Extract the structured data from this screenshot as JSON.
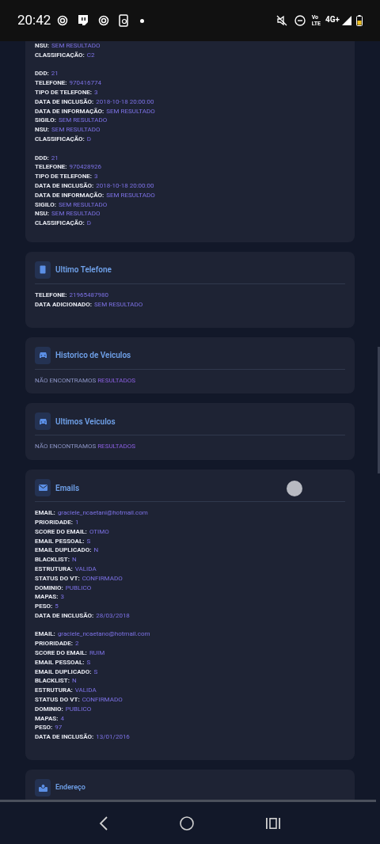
{
  "status_bar": {
    "time": "20:42",
    "volte": [
      "Vo",
      "LTE"
    ],
    "network": "4G+"
  },
  "cards": [
    {
      "groups": [
        [
          {
            "label": "NSU:",
            "value": "SEM RESULTADO"
          },
          {
            "label": "CLASSIFICAÇÃO:",
            "value": "C2"
          }
        ],
        [
          {
            "label": "DDD:",
            "value": "21"
          },
          {
            "label": "TELEFONE:",
            "value": "970416774"
          },
          {
            "label": "TIPO DE TELEFONE:",
            "value": "3"
          },
          {
            "label": "DATA DE INCLUSÃO:",
            "value": "2018-10-18 20:00:00"
          },
          {
            "label": "DATA DE INFORMAÇÃO:",
            "value": "SEM RESULTADO"
          },
          {
            "label": "SIGILO:",
            "value": "SEM RESULTADO"
          },
          {
            "label": "NSU:",
            "value": "SEM RESULTADO"
          },
          {
            "label": "CLASSIFICAÇÃO:",
            "value": "D"
          }
        ],
        [
          {
            "label": "DDD:",
            "value": "21"
          },
          {
            "label": "TELEFONE:",
            "value": "970428926"
          },
          {
            "label": "TIPO DE TELEFONE:",
            "value": "3"
          },
          {
            "label": "DATA DE INCLUSÃO:",
            "value": "2018-10-18 20:00:00"
          },
          {
            "label": "DATA DE INFORMAÇÃO:",
            "value": "SEM RESULTADO"
          },
          {
            "label": "SIGILO:",
            "value": "SEM RESULTADO"
          },
          {
            "label": "NSU:",
            "value": "SEM RESULTADO"
          },
          {
            "label": "CLASSIFICAÇÃO:",
            "value": "D"
          }
        ]
      ]
    },
    {
      "kind": "phone",
      "title": "Ultimo Telefone",
      "groups": [
        [
          {
            "label": "TELEFONE:",
            "value": "21965487980"
          },
          {
            "label": "DATA ADICIONADO:",
            "value": "SEM RESULTADO"
          }
        ]
      ]
    },
    {
      "kind": "car",
      "title": "Historico de Veiculos",
      "empty": [
        "NÃO ENCONTRAMOS",
        "RESULTADOS"
      ]
    },
    {
      "kind": "car",
      "title": "Ultimos Veiculos",
      "empty": [
        "NÃO ENCONTRAMOS",
        "RESULTADOS"
      ]
    },
    {
      "kind": "mail",
      "title": "Emails",
      "groups": [
        [
          {
            "label": "EMAIL:",
            "value": "graciele_ncaetani@hotmail.com"
          },
          {
            "label": "PRIORIDADE:",
            "value": "1"
          },
          {
            "label": "SCORE DO EMAIL:",
            "value": "OTIMO"
          },
          {
            "label": "EMAIL PESSOAL:",
            "value": "S"
          },
          {
            "label": "EMAIL DUPLICADO:",
            "value": "N"
          },
          {
            "label": "BLACKLIST:",
            "value": "N"
          },
          {
            "label": "ESTRUTURA:",
            "value": "VALIDA"
          },
          {
            "label": "STATUS DO VT:",
            "value": "CONFIRMADO"
          },
          {
            "label": "DOMINIO:",
            "value": "PUBLICO"
          },
          {
            "label": "MAPAS:",
            "value": "3"
          },
          {
            "label": "PESO:",
            "value": "5"
          },
          {
            "label": "DATA DE INCLUSÃO:",
            "value": "28/03/2018"
          }
        ],
        [
          {
            "label": "EMAIL:",
            "value": "graciele_ncaetano@hotmail.com"
          },
          {
            "label": "PRIORIDADE:",
            "value": "2"
          },
          {
            "label": "SCORE DO EMAIL:",
            "value": "RUIM"
          },
          {
            "label": "EMAIL PESSOAL:",
            "value": "S"
          },
          {
            "label": "EMAIL DUPLICADO:",
            "value": "S"
          },
          {
            "label": "BLACKLIST:",
            "value": "N"
          },
          {
            "label": "ESTRUTURA:",
            "value": "VALIDA"
          },
          {
            "label": "STATUS DO VT:",
            "value": "CONFIRMADO"
          },
          {
            "label": "DOMINIO:",
            "value": "PUBLICO"
          },
          {
            "label": "MAPAS:",
            "value": "4"
          },
          {
            "label": "PESO:",
            "value": "97"
          },
          {
            "label": "DATA DE INCLUSÃO:",
            "value": "13/01/2016"
          }
        ]
      ]
    },
    {
      "kind": "map",
      "title": "Endereço"
    }
  ]
}
